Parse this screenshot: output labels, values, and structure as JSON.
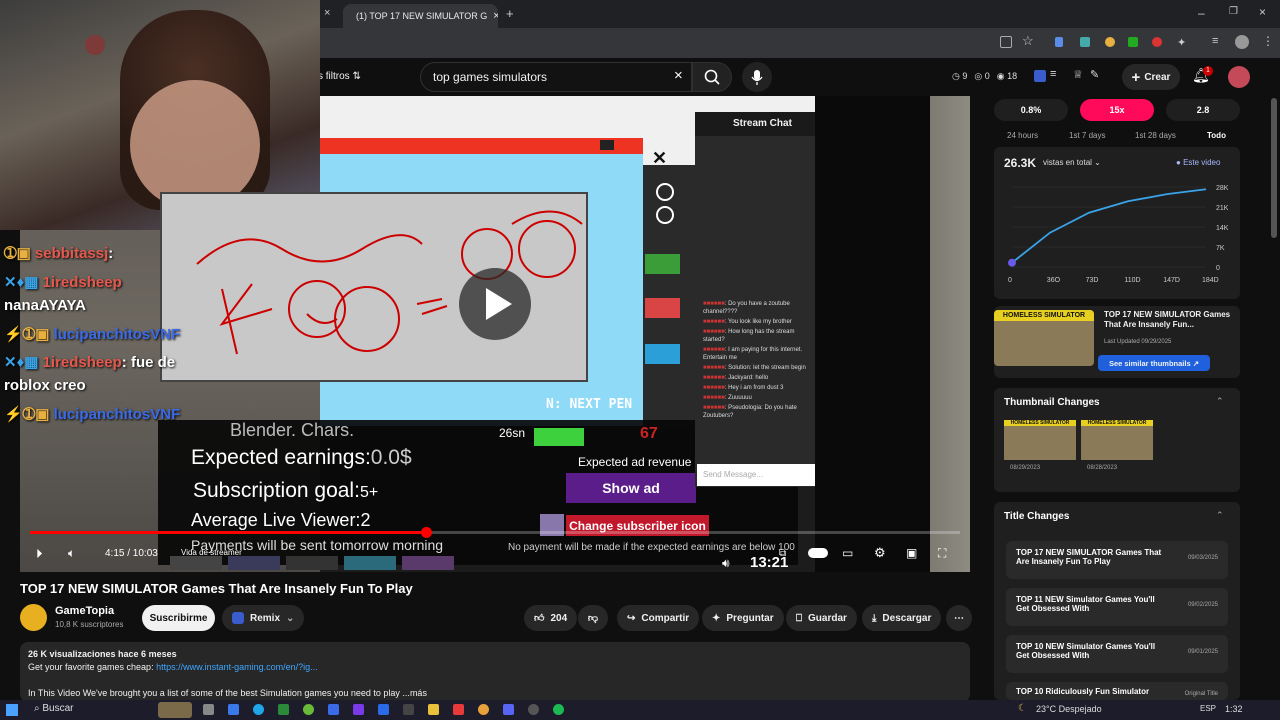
{
  "browser": {
    "tab_title": "(1) TOP 17 NEW SIMULATOR G",
    "tab_close": "×",
    "new_tab": "+"
  },
  "youtube": {
    "filters": "s filtros",
    "search_value": "top games simulators",
    "stats": {
      "views": "9",
      "zero": "0",
      "count": "18"
    },
    "create_label": "Crear",
    "notif_count": "1"
  },
  "overlay_chat": [
    {
      "user": "sebbitassj",
      "msg": ""
    },
    {
      "user": "1iredsheep",
      "msg": ""
    },
    {
      "user": "",
      "msg": "nanaAYAYA"
    },
    {
      "user": "lucipanchitosVNF",
      "msg": ""
    },
    {
      "user": "1iredsheep",
      "msg": "fue de"
    },
    {
      "user": "",
      "msg": "roblox creo"
    },
    {
      "user": "lucipanchitosVNF",
      "msg": ""
    }
  ],
  "video_overlay": {
    "expected_earnings": "Expected earnings:",
    "expected_value": "0.0$",
    "subscription_goal": "Subscription goal:",
    "subscription_value": "5+",
    "avg_viewer": "Average Live Viewer:",
    "avg_value": "2",
    "payments": "Payments will be sent tomorrow morning",
    "no_payment": "No payment will be made if the expected earnings are below 100",
    "expected_ad": "Expected ad revenue",
    "show_ad": "Show ad",
    "change_sub": "Change subscriber icon",
    "next_pen": "N: NEXT PEN",
    "stream_chat": "Stream Chat",
    "send_placeholder": "Send Message...",
    "vida": "Vida de streamer",
    "game_time": "13:21",
    "sub_count_left": "26sn",
    "sub_count_right": "67",
    "blender": "Blender. Chars.",
    "stream_chat_msgs": [
      "Do you have a zoutube channel????",
      "You look like my brother",
      "How long has the stream started?",
      "I am paying for this internet. Entertain me",
      "Solution: let the stream begin",
      "Jackyard: hello",
      "Hey i am from dust 3",
      "Zuuuuuu",
      "Pseudologia: Do you hate Zoutubers?"
    ]
  },
  "player": {
    "time": "4:15 / 10:03",
    "progress": 0.42
  },
  "video": {
    "title": "TOP 17 NEW SIMULATOR Games That Are Insanely Fun To Play",
    "channel": "GameTopia",
    "subs": "10,8 K suscriptores",
    "subscribe": "Suscribirme",
    "remix": "Remix",
    "likes": "204",
    "share": "Compartir",
    "ask": "Preguntar",
    "save": "Guardar",
    "download": "Descargar",
    "desc_stats": "26 K visualizaciones  hace 6 meses",
    "desc_line1": "Get your favorite games cheap: ",
    "desc_link": "https://www.instant-gaming.com/en/?ig...",
    "desc_line2": "In This Video We've brought you a list of some of the best Simulation games you need to play ...más"
  },
  "sidebar": {
    "pills": [
      "0.8%",
      "15x",
      "2.8"
    ],
    "ranges": [
      "24 hours",
      "1st 7 days",
      "1st 28 days",
      "Todo"
    ],
    "views_total": "26.3K",
    "views_select": "vistas en total",
    "legend": "Este video",
    "y_ticks": [
      "28K",
      "21K",
      "14K",
      "7K",
      "0"
    ],
    "x_ticks": [
      "0",
      "36O",
      "73D",
      "110D",
      "147D",
      "184D"
    ],
    "thumb_title": "TOP 17 NEW SIMULATOR Games That Are Insanely Fun...",
    "last_updated": "Last Updated 09/29/2025",
    "see_similar": "See similar thumbnails",
    "thumb_changes": "Thumbnail Changes",
    "thumb_dates": [
      "08/29/2023",
      "08/28/2023"
    ],
    "title_changes": "Title Changes",
    "title_items": [
      {
        "title": "TOP 17 NEW SIMULATOR Games That Are Insanely Fun To Play",
        "date": "09/03/2025"
      },
      {
        "title": "TOP 11 NEW Simulator Games You'll Get Obsessed With",
        "date": "09/02/2025"
      },
      {
        "title": "TOP 10 NEW Simulator Games You'll Get Obsessed With",
        "date": "09/01/2025"
      },
      {
        "title": "TOP 10 Ridiculously Fun Simulator",
        "date": "Original Title"
      }
    ],
    "homeless_label": "HOMELESS SIMULATOR"
  },
  "chart_data": {
    "type": "line",
    "x": [
      0,
      36,
      73,
      110,
      147,
      184
    ],
    "series": [
      {
        "name": "Este video",
        "values": [
          1500,
          12000,
          19000,
          23000,
          25500,
          27200
        ]
      }
    ],
    "ylim": [
      0,
      28000
    ]
  },
  "taskbar": {
    "search": "Buscar",
    "weather": "23°C  Despejado",
    "lang": "ESP",
    "clock": "1:32"
  },
  "colors": {
    "accent": "#ff0033",
    "brand_red": "#ff0000",
    "sidebar_bg": "#1f1f1f"
  }
}
